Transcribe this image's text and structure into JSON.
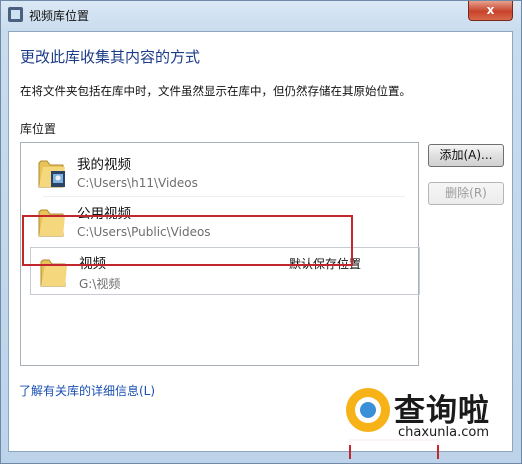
{
  "window": {
    "title": "视频库位置",
    "close_glyph": "x"
  },
  "content": {
    "heading": "更改此库收集其内容的方式",
    "description": "在将文件夹包括在库中时，文件虽然显示在库中，但仍然存储在其原始位置。",
    "locations_label": "库位置"
  },
  "locations": [
    {
      "name": "我的视频",
      "path": "C:\\Users\\h11\\Videos",
      "default_label": "",
      "icon": "video-folder-icon"
    },
    {
      "name": "公用视频",
      "path": "C:\\Users\\Public\\Videos",
      "default_label": "",
      "icon": "folder-icon"
    },
    {
      "name": "视频",
      "path": "G:\\视频",
      "default_label": "默认保存位置",
      "icon": "folder-icon"
    }
  ],
  "buttons": {
    "add": "添加(A)...",
    "remove": "删除(R)"
  },
  "link": {
    "learn_more": "了解有关库的详细信息(L)"
  },
  "watermark": {
    "brand": "查询啦",
    "url": "chaxunla.com"
  },
  "colors": {
    "highlight": "#c1272d",
    "heading": "#1c3c88",
    "link": "#1b4fb2"
  }
}
